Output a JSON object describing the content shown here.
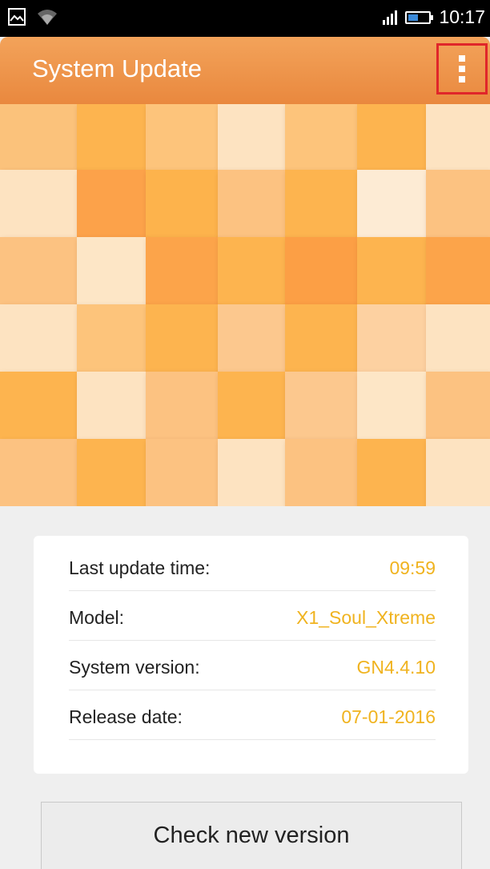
{
  "status_bar": {
    "time": "10:17",
    "icons": [
      "image-icon",
      "wifi-icon",
      "signal-icon",
      "battery-icon"
    ]
  },
  "action_bar": {
    "title": "System Update",
    "overflow_icon": "more-vertical-icon",
    "color": "#ee9548"
  },
  "info": {
    "rows": [
      {
        "label": "Last update time:",
        "value": "09:59"
      },
      {
        "label": "Model:",
        "value": "X1_Soul_Xtreme"
      },
      {
        "label": "System version:",
        "value": "GN4.4.10"
      },
      {
        "label": "Release date:",
        "value": "07-01-2016"
      }
    ],
    "value_color": "#f0b31f"
  },
  "button": {
    "label": "Check new version"
  }
}
